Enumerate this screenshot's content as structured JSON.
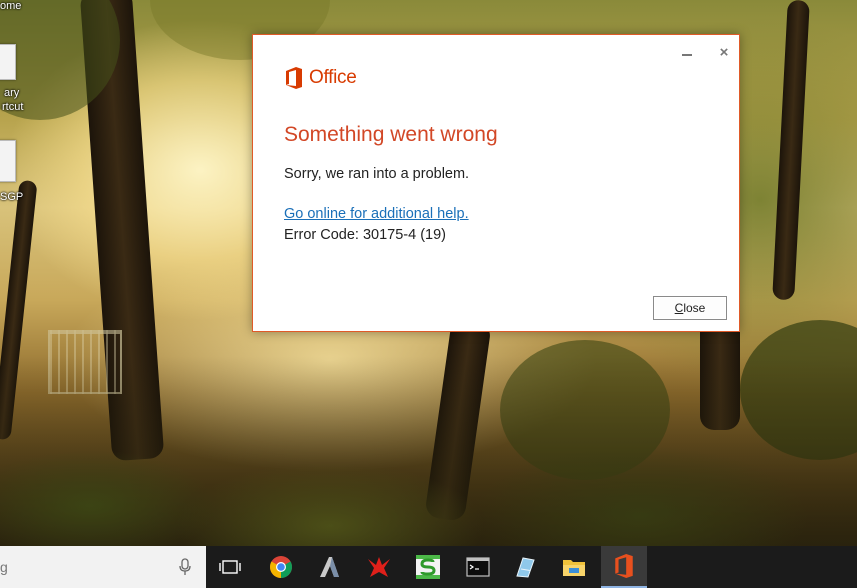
{
  "desktop": {
    "icon_labels": [
      "ome",
      "ary",
      "rtcut",
      "SGP"
    ]
  },
  "dialog": {
    "app_name": "Office",
    "heading": "Something went wrong",
    "message": "Sorry, we ran into a problem.",
    "help_link": "Go online for additional help.",
    "error_code": "Error Code: 30175-4 (19)",
    "close_button": {
      "accel": "C",
      "rest": "lose"
    },
    "close_x": "×",
    "accent_color": "#d24726"
  },
  "taskbar": {
    "search_text": "g",
    "items": [
      "task-view-icon",
      "chrome-icon",
      "autocad-icon",
      "red-app-icon",
      "green-s-app-icon",
      "command-prompt-icon",
      "notebook-app-icon",
      "file-explorer-icon",
      "office-icon"
    ]
  }
}
